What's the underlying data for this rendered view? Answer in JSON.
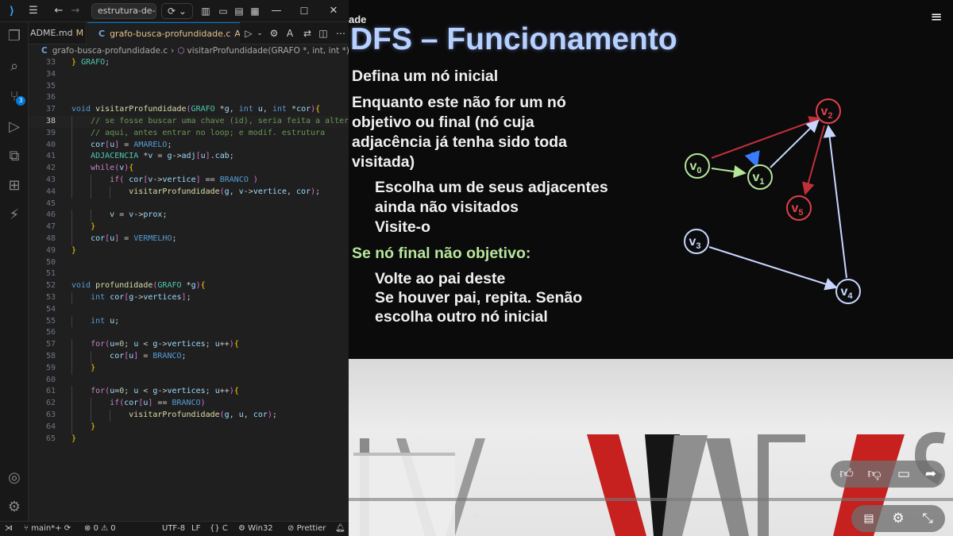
{
  "window": {
    "command_center": "estrutura-de-dado",
    "copilot_icon": "copilot-icon"
  },
  "tabs": [
    {
      "label": "ADME.md",
      "status": "M"
    },
    {
      "label": "grafo-busca-profundidade.c",
      "status": "A",
      "icon": "C"
    }
  ],
  "breadcrumb": {
    "icon": "C",
    "file": "grafo-busca-profundidade.c",
    "symbol": "visitarProfundidade(GRAFO *, int, int *)"
  },
  "activity_badge": "3",
  "editor": {
    "line_numbers": [
      "33",
      "34",
      "35",
      "36",
      "37",
      "38",
      "39",
      "40",
      "41",
      "42",
      "43",
      "44",
      "45",
      "46",
      "47",
      "48",
      "49",
      "50",
      "51",
      "52",
      "53",
      "54",
      "55",
      "56",
      "57",
      "58",
      "59",
      "60",
      "61",
      "62",
      "63",
      "64",
      "65"
    ],
    "current_line": "38",
    "lines": [
      "} GRAFO;",
      "",
      "",
      "",
      "void visitarProfundidade(GRAFO *g, int u, int *cor){",
      "    // se fosse buscar uma chave (id), seria feita a alter",
      "    // aqui, antes entrar no loop; e modif. estrutura",
      "    cor[u] = AMARELO;",
      "    ADJACENCIA *v = g->adj[u].cab;",
      "    while(v){",
      "        if( cor[v->vertice] == BRANCO )",
      "            visitarProfundidade(g, v->vertice, cor);",
      "",
      "        v = v->prox;",
      "    }",
      "    cor[u] = VERMELHO;",
      "}",
      "",
      "",
      "void profundidade(GRAFO *g){",
      "    int cor[g->vertices];",
      "",
      "    int u;",
      "",
      "    for(u=0; u < g->vertices; u++){",
      "        cor[u] = BRANCO;",
      "    }",
      "",
      "    for(u=0; u < g->vertices; u++){",
      "        if(cor[u] == BRANCO)",
      "            visitarProfundidade(g, u, cor);",
      "    }",
      "}"
    ]
  },
  "statusbar": {
    "branch": "main*+",
    "errors": "0",
    "warnings": "0",
    "encoding": "UTF-8",
    "eol": "LF",
    "language": "C",
    "platform": "Win32",
    "formatter": "Prettier"
  },
  "slide": {
    "corner_text": "ade",
    "title": "DFS – Funcionamento",
    "lines": [
      {
        "text": "Defina um nó inicial",
        "color": "#f0f0f0"
      },
      {
        "text": "Enquanto este não for um nó",
        "color": "#f0f0f0"
      },
      {
        "text": "objetivo ou final (nó cuja",
        "color": "#f0f0f0"
      },
      {
        "text": "adjacência já tenha sido toda",
        "color": "#f0f0f0"
      },
      {
        "text": "visitada)",
        "color": "#f0f0f0"
      },
      {
        "text": "Escolha um de seus adjacentes",
        "color": "#f0f0f0"
      },
      {
        "text": "ainda não visitados",
        "color": "#f0f0f0"
      },
      {
        "text": "Visite-o",
        "color": "#f0f0f0"
      },
      {
        "text": "Se nó final não objetivo:",
        "color": "#b6e69a"
      },
      {
        "text": "Volte ao pai deste",
        "color": "#f0f0f0"
      },
      {
        "text": "Se houver pai, repita. Senão",
        "color": "#f0f0f0"
      },
      {
        "text": "escolha outro nó inicial",
        "color": "#f0f0f0"
      }
    ],
    "graph": {
      "nodes": [
        {
          "label": "v",
          "sub": "0",
          "color": "#b6e69a"
        },
        {
          "label": "v",
          "sub": "1",
          "color": "#b6e69a"
        },
        {
          "label": "v",
          "sub": "2",
          "color": "#e0404a"
        },
        {
          "label": "v",
          "sub": "3",
          "color": "#c8d6ff"
        },
        {
          "label": "v",
          "sub": "4",
          "color": "#c8d6ff"
        },
        {
          "label": "v",
          "sub": "5",
          "color": "#e0404a"
        }
      ]
    }
  },
  "video_controls": {
    "like": "thumbs-up-icon",
    "dislike": "thumbs-down-icon",
    "comment": "comment-icon",
    "share": "share-icon",
    "captions": "captions-icon",
    "settings": "gear-icon",
    "exit_fullscreen": "collapse-icon"
  }
}
